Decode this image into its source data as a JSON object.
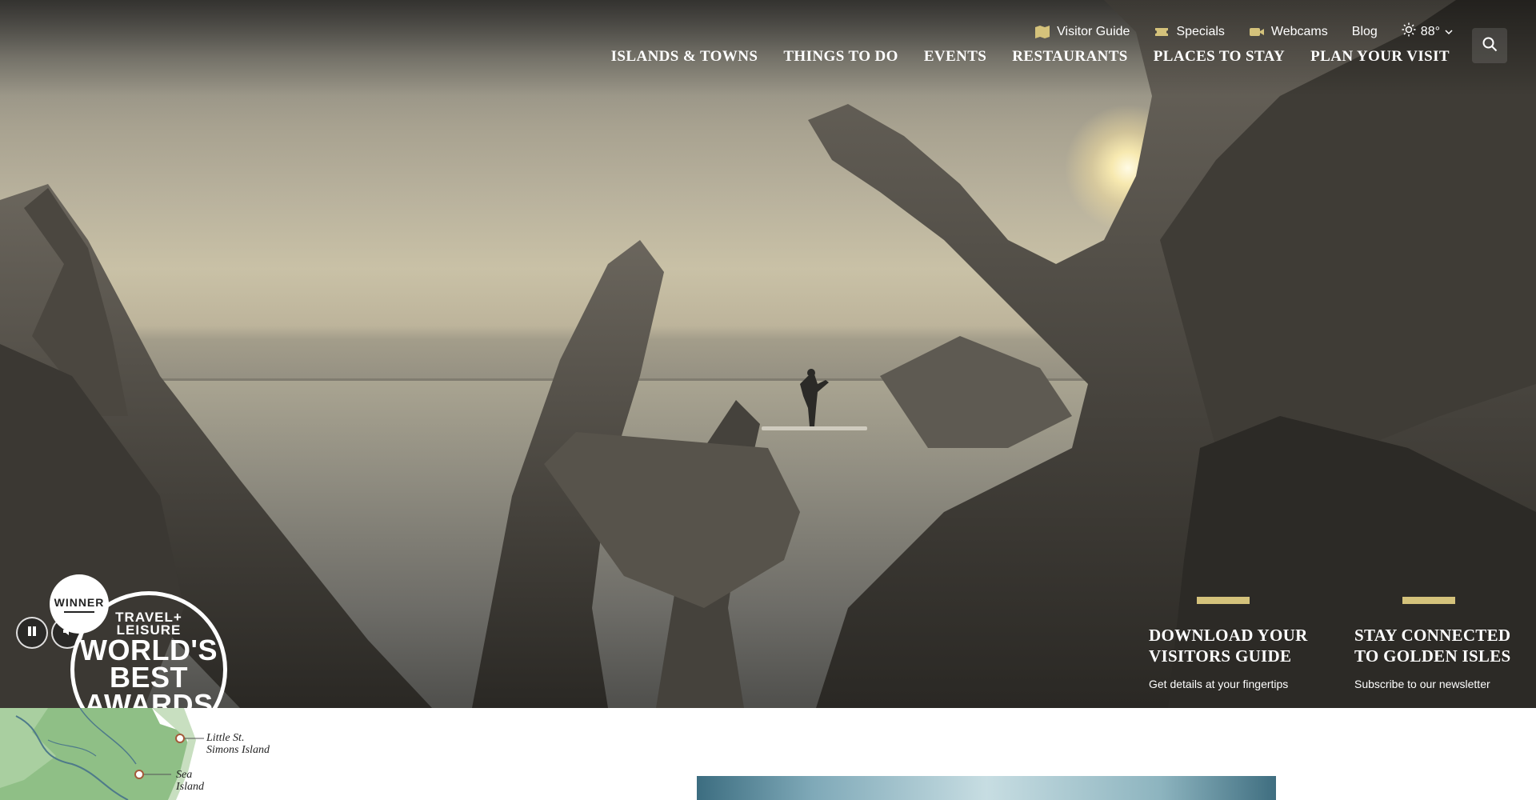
{
  "utility_nav": {
    "items": [
      {
        "label": "Visitor Guide",
        "icon": "map-icon"
      },
      {
        "label": "Specials",
        "icon": "ticket-icon"
      },
      {
        "label": "Webcams",
        "icon": "camera-icon"
      },
      {
        "label": "Blog",
        "icon": ""
      }
    ],
    "weather": {
      "temperature": "88°",
      "icon": "sun-icon"
    }
  },
  "main_nav": {
    "items": [
      {
        "label": "Islands & Towns"
      },
      {
        "label": "Things to Do"
      },
      {
        "label": "Events"
      },
      {
        "label": "Restaurants"
      },
      {
        "label": "Places to Stay"
      },
      {
        "label": "Plan Your Visit"
      }
    ]
  },
  "search": {
    "icon": "search-icon"
  },
  "video_controls": {
    "pause_icon": "pause-icon",
    "mute_icon": "volume-icon"
  },
  "award": {
    "winner": "WINNER",
    "line1": "TRAVEL+",
    "line2": "LEISURE",
    "line3": "WORLD'S",
    "line4": "BEST",
    "line5": "AWARDS"
  },
  "ctas": [
    {
      "title_line1": "Download Your",
      "title_line2": "Visitors Guide",
      "subtitle": "Get details at your fingertips"
    },
    {
      "title_line1": "Stay Connected",
      "title_line2": "to Golden Isles",
      "subtitle": "Subscribe to our newsletter"
    }
  ],
  "map": {
    "labels": [
      {
        "line1": "Little St.",
        "line2": "Simons Island"
      },
      {
        "line1": "Sea",
        "line2": "Island"
      }
    ]
  },
  "colors": {
    "accent_gold": "#d4c27b",
    "map_green": "#8fbf86"
  }
}
